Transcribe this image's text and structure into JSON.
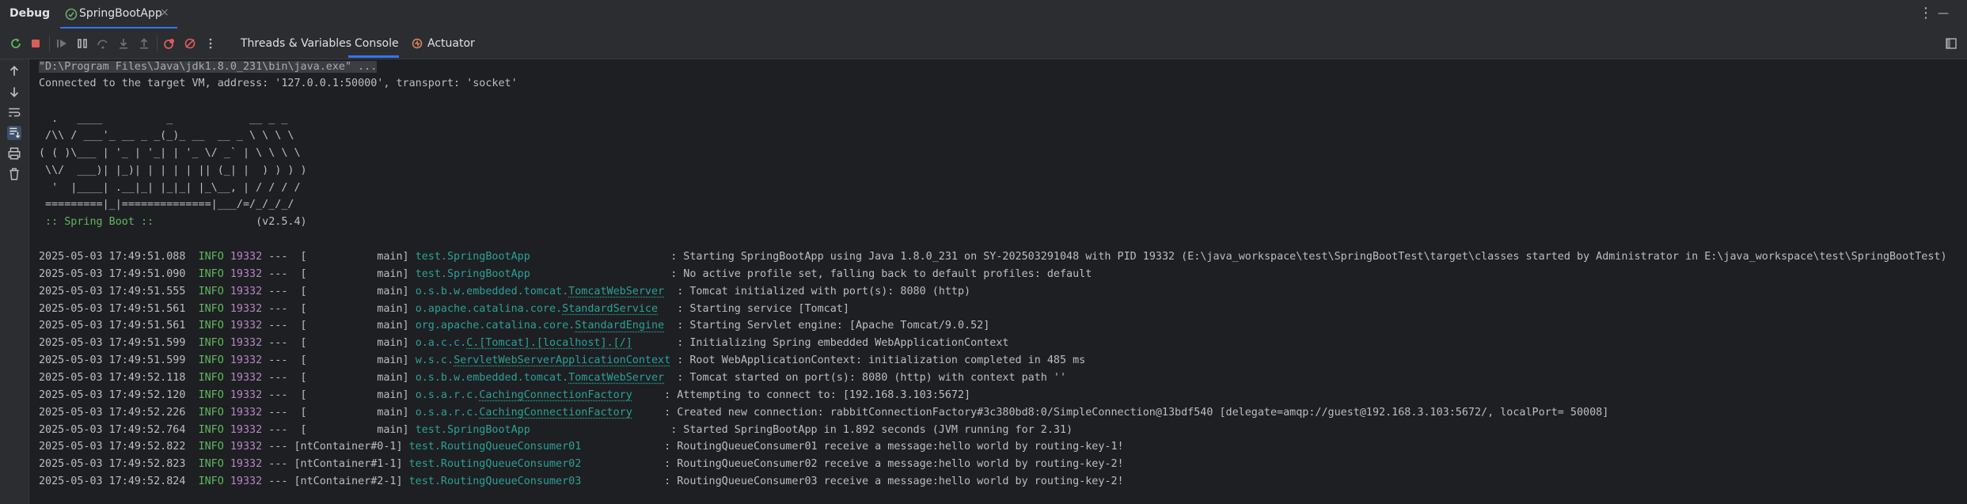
{
  "titlebar": {
    "title": "Debug",
    "tab_label": "SpringBootApp",
    "tab_close": "×",
    "more": "⋮",
    "minimize": "—"
  },
  "toolbar": {
    "tabs": [
      "Threads & Variables",
      "Console",
      "Actuator"
    ],
    "active_tab": "Console"
  },
  "colors": {
    "accent": "#3574f0",
    "info": "#5fb85f",
    "pid": "#b784c7",
    "logger": "#2aa198",
    "rerun": "#5fb85f",
    "stop": "#db5c5c"
  },
  "console": {
    "cmd": "\"D:\\Program Files\\Java\\jdk1.8.0_231\\bin\\java.exe\" ...",
    "connected": "Connected to the target VM, address: '127.0.0.1:50000', transport: 'socket'",
    "banner": [
      "  .   ____          _            __ _ _",
      " /\\\\ / ___'_ __ _ _(_)_ __  __ _ \\ \\ \\ \\",
      "( ( )\\___ | '_ | '_| | '_ \\/ _` | \\ \\ \\ \\",
      " \\\\/  ___)| |_)| | | | | || (_| |  ) ) ) )",
      "  '  |____| .__|_| |_|_| |_\\__, | / / / /",
      " =========|_|==============|___/=/_/_/_/"
    ],
    "spring_label": " :: Spring Boot :: ",
    "spring_version": "               (v2.5.4)",
    "logs": [
      {
        "ts": "2025-05-03 17:49:51.088",
        "level": "INFO",
        "pid": "19332",
        "thread": "---  [           main]",
        "logger_pre": "test.SpringBootApp",
        "logger_ul": "",
        "pad": "                      ",
        "msg": ": Starting SpringBootApp using Java 1.8.0_231 on SY-202503291048 with PID 19332 (E:\\java_workspace\\test\\SpringBootTest\\target\\classes started by Administrator in E:\\java_workspace\\test\\SpringBootTest)"
      },
      {
        "ts": "2025-05-03 17:49:51.090",
        "level": "INFO",
        "pid": "19332",
        "thread": "---  [           main]",
        "logger_pre": "test.SpringBootApp",
        "logger_ul": "",
        "pad": "                      ",
        "msg": ": No active profile set, falling back to default profiles: default"
      },
      {
        "ts": "2025-05-03 17:49:51.555",
        "level": "INFO",
        "pid": "19332",
        "thread": "---  [           main]",
        "logger_pre": "o.s.b.w.embedded.tomcat.",
        "logger_ul": "TomcatWebServer",
        "pad": "  ",
        "msg": ": Tomcat initialized with port(s): 8080 (http)"
      },
      {
        "ts": "2025-05-03 17:49:51.561",
        "level": "INFO",
        "pid": "19332",
        "thread": "---  [           main]",
        "logger_pre": "o.apache.catalina.core.",
        "logger_ul": "StandardService",
        "pad": "   ",
        "msg": ": Starting service [Tomcat]"
      },
      {
        "ts": "2025-05-03 17:49:51.561",
        "level": "INFO",
        "pid": "19332",
        "thread": "---  [           main]",
        "logger_pre": "org.apache.catalina.core.",
        "logger_ul": "StandardEngine",
        "pad": "  ",
        "msg": ": Starting Servlet engine: [Apache Tomcat/9.0.52]"
      },
      {
        "ts": "2025-05-03 17:49:51.599",
        "level": "INFO",
        "pid": "19332",
        "thread": "---  [           main]",
        "logger_pre": "o.a.c.c.",
        "logger_ul": "C.[Tomcat].[localhost].[/]",
        "pad": "       ",
        "msg": ": Initializing Spring embedded WebApplicationContext"
      },
      {
        "ts": "2025-05-03 17:49:51.599",
        "level": "INFO",
        "pid": "19332",
        "thread": "---  [           main]",
        "logger_pre": "w.s.c.",
        "logger_ul": "ServletWebServerApplicationContext",
        "pad": " ",
        "msg": ": Root WebApplicationContext: initialization completed in 485 ms"
      },
      {
        "ts": "2025-05-03 17:49:52.118",
        "level": "INFO",
        "pid": "19332",
        "thread": "---  [           main]",
        "logger_pre": "o.s.b.w.embedded.tomcat.",
        "logger_ul": "TomcatWebServer",
        "pad": "  ",
        "msg": ": Tomcat started on port(s): 8080 (http) with context path ''"
      },
      {
        "ts": "2025-05-03 17:49:52.120",
        "level": "INFO",
        "pid": "19332",
        "thread": "---  [           main]",
        "logger_pre": "o.s.a.r.c.",
        "logger_ul": "CachingConnectionFactory",
        "pad": "     ",
        "msg": ": Attempting to connect to: [192.168.3.103:5672]"
      },
      {
        "ts": "2025-05-03 17:49:52.226",
        "level": "INFO",
        "pid": "19332",
        "thread": "---  [           main]",
        "logger_pre": "o.s.a.r.c.",
        "logger_ul": "CachingConnectionFactory",
        "pad": "     ",
        "msg": ": Created new connection: rabbitConnectionFactory#3c380bd8:0/SimpleConnection@13bdf540 [delegate=amqp://guest@192.168.3.103:5672/, localPort= 50008]"
      },
      {
        "ts": "2025-05-03 17:49:52.764",
        "level": "INFO",
        "pid": "19332",
        "thread": "---  [           main]",
        "logger_pre": "test.SpringBootApp",
        "logger_ul": "",
        "pad": "                      ",
        "msg": ": Started SpringBootApp in 1.892 seconds (JVM running for 2.31)"
      },
      {
        "ts": "2025-05-03 17:49:52.822",
        "level": "INFO",
        "pid": "19332",
        "thread": "--- [ntContainer#0-1]",
        "logger_pre": "test.RoutingQueueConsumer01",
        "logger_ul": "",
        "pad": "             ",
        "msg": ": RoutingQueueConsumer01 receive a message:hello world by routing-key-1!"
      },
      {
        "ts": "2025-05-03 17:49:52.823",
        "level": "INFO",
        "pid": "19332",
        "thread": "--- [ntContainer#1-1]",
        "logger_pre": "test.RoutingQueueConsumer02",
        "logger_ul": "",
        "pad": "             ",
        "msg": ": RoutingQueueConsumer02 receive a message:hello world by routing-key-2!"
      },
      {
        "ts": "2025-05-03 17:49:52.824",
        "level": "INFO",
        "pid": "19332",
        "thread": "--- [ntContainer#2-1]",
        "logger_pre": "test.RoutingQueueConsumer03",
        "logger_ul": "",
        "pad": "             ",
        "msg": ": RoutingQueueConsumer03 receive a message:hello world by routing-key-2!"
      }
    ]
  }
}
